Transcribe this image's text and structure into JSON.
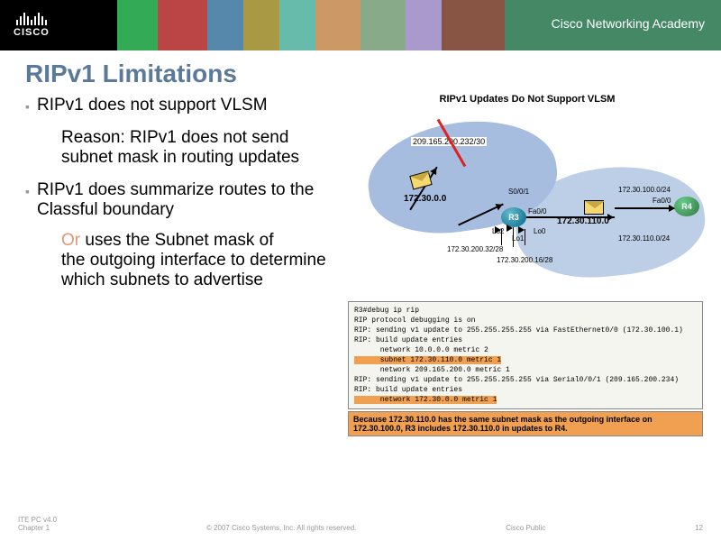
{
  "header": {
    "logo_text": "CISCO",
    "academy": "Cisco Networking Academy"
  },
  "title": "RIPv1 Limitations",
  "bullets": {
    "b1": "RIPv1 does not support VLSM",
    "sub1": "Reason: RIPv1 does not send subnet mask in routing updates",
    "b2": "RIPv1 does summarize routes to the Classful boundary",
    "or": "Or ",
    "sub2": "uses the Subnet mask of the outgoing interface to determine which subnets to advertise"
  },
  "diagram": {
    "title": "RIPv1 Updates Do Not Support VLSM",
    "net1": "209.165.200.232/30",
    "ip1": "172.30.0.0",
    "ip2": "172.30.110.0",
    "s001": "S0/0/1",
    "fa00a": "Fa0/0",
    "fa00b": "Fa0/0",
    "lo0": "Lo0",
    "lo1": "Lo1",
    "lo2": "Lo2",
    "sn1": "172.30.200.32/28",
    "sn2": "172.30.200.16/28",
    "sn3": "172.30.110.0/24",
    "sn4": "172.30.100.0/24",
    "r3": "R3",
    "r4": "R4"
  },
  "console": {
    "l0": "R3#debug ip rip",
    "l1": "RIP protocol debugging is on",
    "l2": "RIP: sending v1 update to 255.255.255.255 via FastEthernet0/0 (172.30.100.1)",
    "l3": "RIP: build update entries",
    "l4": "      network 10.0.0.0 metric 2",
    "l5": "      subnet 172.30.110.0 metric 1",
    "l6": "      network 209.165.200.0 metric 1",
    "l7": "RIP: sending v1 update to 255.255.255.255 via Serial0/0/1 (209.165.200.234)",
    "l8": "RIP: build update entries",
    "l9": "      network 172.30.0.0 metric 1"
  },
  "note": "Because 172.30.110.0 has the same subnet mask as the outgoing interface on 172.30.100.0, R3 includes 172.30.110.0 in updates to R4.",
  "footer": {
    "left1": "ITE PC v4.0",
    "left2": "Chapter 1",
    "center": "© 2007 Cisco Systems, Inc. All rights reserved.",
    "right1": "Cisco Public",
    "page": "12"
  }
}
